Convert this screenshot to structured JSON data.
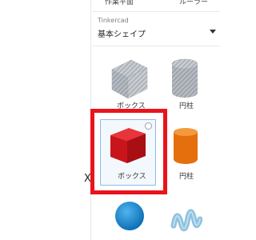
{
  "tabs": {
    "workplane": "作業平面",
    "ruler": "ルーラー"
  },
  "library": {
    "category": "Tinkercad",
    "value": "基本シェイプ"
  },
  "collapse_label": "X",
  "shapes": [
    {
      "label": "ボックス",
      "style": "hole",
      "icon": "box-hole-icon"
    },
    {
      "label": "円柱",
      "style": "hole",
      "icon": "cylinder-hole-icon"
    },
    {
      "label": "ボックス",
      "style": "solid",
      "icon": "box-icon",
      "color": "#d11a20",
      "selected": true
    },
    {
      "label": "円柱",
      "style": "solid",
      "icon": "cylinder-icon",
      "color": "#ec7a16"
    },
    {
      "label": "",
      "style": "solid",
      "icon": "sphere-icon",
      "color": "#1f8fd6"
    },
    {
      "label": "",
      "style": "solid",
      "icon": "scribble-icon",
      "color": "#7fb7d8"
    }
  ],
  "highlight_color": "#e8141d"
}
